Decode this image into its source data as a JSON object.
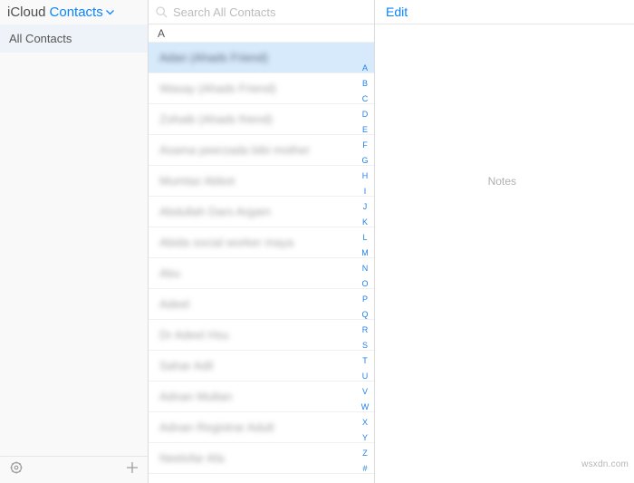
{
  "header": {
    "brand_primary": "iCloud",
    "brand_secondary": "Contacts"
  },
  "sidebar": {
    "groups": [
      "All Contacts"
    ]
  },
  "search": {
    "placeholder": "Search All Contacts",
    "value": ""
  },
  "list": {
    "section_letter": "A",
    "selected_index": 0,
    "rows": [
      "Adan (Ahads Friend)",
      "Wasay (Ahads Friend)",
      "Zohaib (Ahads friend)",
      "Asama peerzada bibi mother",
      "Mumtaz Abbot",
      "Abdullah Dars Argam",
      "Abida social worker maya",
      "Abu",
      "Adeel",
      "Dr Adeel Hsu",
      "Sahar Adil",
      "Adnan Multan",
      "Adnan Registrar Adult",
      "Neelofar Afa"
    ]
  },
  "index_letters": [
    "A",
    "B",
    "C",
    "D",
    "E",
    "F",
    "G",
    "H",
    "I",
    "J",
    "K",
    "L",
    "M",
    "N",
    "O",
    "P",
    "Q",
    "R",
    "S",
    "T",
    "U",
    "V",
    "W",
    "X",
    "Y",
    "Z",
    "#"
  ],
  "detail": {
    "edit_label": "Edit",
    "notes_label": "Notes"
  },
  "watermark": "wsxdn.com"
}
